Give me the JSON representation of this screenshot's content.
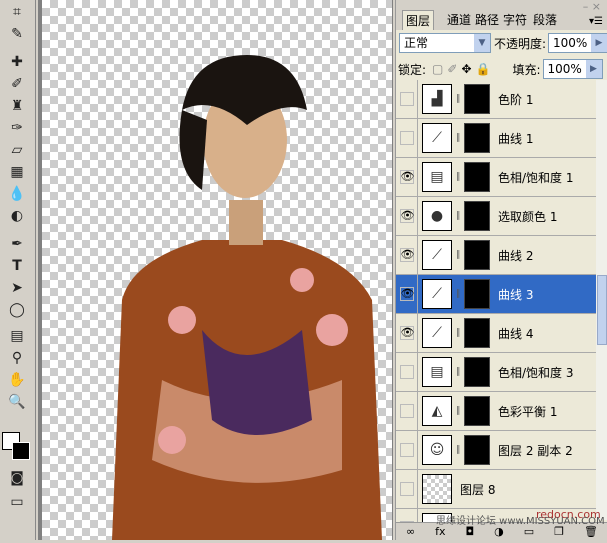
{
  "tools": [
    "crop-icon",
    "slice-icon",
    "healing-icon",
    "brush-icon",
    "stamp-icon",
    "history-brush-icon",
    "eraser-icon",
    "gradient-icon",
    "blur-icon",
    "dodge-icon",
    "pen-icon",
    "type-icon",
    "path-select-icon",
    "shape-icon",
    "notes-icon",
    "eyedropper-icon",
    "hand-icon",
    "zoom-icon"
  ],
  "panel": {
    "tabs": [
      "图层",
      "通道",
      "路径",
      "字符",
      "段落"
    ],
    "blend_mode": "正常",
    "opacity_label": "不透明度:",
    "opacity": "100%",
    "lock_label": "锁定:",
    "fill_label": "填充:",
    "fill": "100%",
    "layers": [
      {
        "name": "色阶 1",
        "visible": false,
        "thumb": "levels"
      },
      {
        "name": "曲线 1",
        "visible": false,
        "thumb": "curves"
      },
      {
        "name": "色相/饱和度 1",
        "visible": true,
        "thumb": "hue"
      },
      {
        "name": "选取颜色 1",
        "visible": true,
        "thumb": "selective"
      },
      {
        "name": "曲线 2",
        "visible": true,
        "thumb": "curves"
      },
      {
        "name": "曲线 3",
        "visible": true,
        "thumb": "curves",
        "selected": true
      },
      {
        "name": "曲线 4",
        "visible": true,
        "thumb": "curves"
      },
      {
        "name": "色相/饱和度 3",
        "visible": false,
        "thumb": "hue"
      },
      {
        "name": "色彩平衡 1",
        "visible": false,
        "thumb": "balance"
      },
      {
        "name": "图层 2 副本 2",
        "visible": false,
        "thumb": "photo"
      },
      {
        "name": "图层 8",
        "visible": false,
        "thumb": "empty"
      }
    ]
  },
  "watermarks": {
    "site1": "redocn.com",
    "site2": "思缘设计论坛 www.MISSYUAN.COM"
  },
  "colors": {
    "selection": "#316ac5"
  }
}
